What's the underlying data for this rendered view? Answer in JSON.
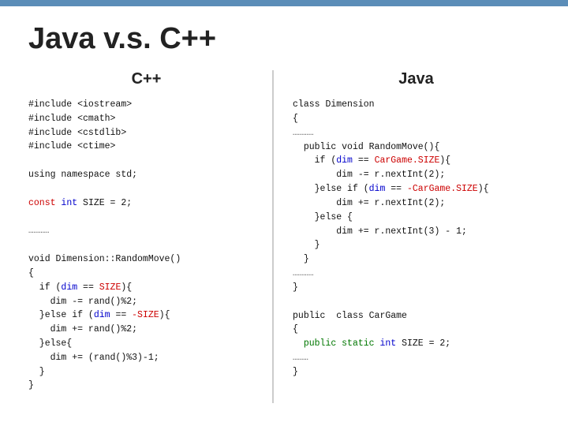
{
  "topbar": {
    "color": "#5b8db8"
  },
  "title": "Java v.s. C++",
  "left_header": "C++",
  "right_header": "Java",
  "left_code": {
    "lines": [
      {
        "text": "#include <iostream>",
        "type": "plain"
      },
      {
        "text": "#include <cmath>",
        "type": "plain"
      },
      {
        "text": "#include <cstdlib>",
        "type": "plain"
      },
      {
        "text": "#include <ctime>",
        "type": "plain"
      },
      {
        "text": "",
        "type": "plain"
      },
      {
        "text": "using namespace std;",
        "type": "plain"
      },
      {
        "text": "",
        "type": "plain"
      },
      {
        "text": "const int SIZE = 2;",
        "type": "const"
      },
      {
        "text": "",
        "type": "plain"
      },
      {
        "text": "…………",
        "type": "dots"
      },
      {
        "text": "",
        "type": "plain"
      },
      {
        "text": "void Dimension::RandomMove()",
        "type": "plain"
      },
      {
        "text": "{",
        "type": "plain"
      },
      {
        "text": "  if (dim == SIZE){",
        "type": "if"
      },
      {
        "text": "    dim -= rand()%2;",
        "type": "plain"
      },
      {
        "text": "  }else if (dim == -SIZE){",
        "type": "else_if"
      },
      {
        "text": "    dim += rand()%2;",
        "type": "plain"
      },
      {
        "text": "  }else{",
        "type": "plain"
      },
      {
        "text": "    dim += (rand()%3)-1;",
        "type": "plain"
      },
      {
        "text": "  }",
        "type": "plain"
      },
      {
        "text": "}",
        "type": "plain"
      }
    ]
  },
  "right_code": {
    "lines": [
      {
        "text": "class Dimension",
        "type": "plain"
      },
      {
        "text": "{",
        "type": "plain"
      },
      {
        "text": "…………",
        "type": "dots"
      },
      {
        "text": "  public void RandomMove(){",
        "type": "plain"
      },
      {
        "text": "    if (dim == CarGame.SIZE){",
        "type": "if"
      },
      {
        "text": "        dim -= r.nextInt(2);",
        "type": "plain"
      },
      {
        "text": "    }else if (dim == -CarGame.SIZE){",
        "type": "else_if"
      },
      {
        "text": "        dim += r.nextInt(2);",
        "type": "plain"
      },
      {
        "text": "    }else {",
        "type": "plain"
      },
      {
        "text": "        dim += r.nextInt(3) - 1;",
        "type": "plain"
      },
      {
        "text": "    }",
        "type": "plain"
      },
      {
        "text": "  }",
        "type": "plain"
      },
      {
        "text": "…………",
        "type": "dots"
      },
      {
        "text": "}",
        "type": "plain"
      },
      {
        "text": "",
        "type": "plain"
      },
      {
        "text": "public  class CarGame",
        "type": "plain"
      },
      {
        "text": "{",
        "type": "plain"
      },
      {
        "text": "  public static int SIZE = 2;",
        "type": "static_int"
      },
      {
        "text": "………",
        "type": "dots"
      },
      {
        "text": "}",
        "type": "plain"
      }
    ]
  }
}
